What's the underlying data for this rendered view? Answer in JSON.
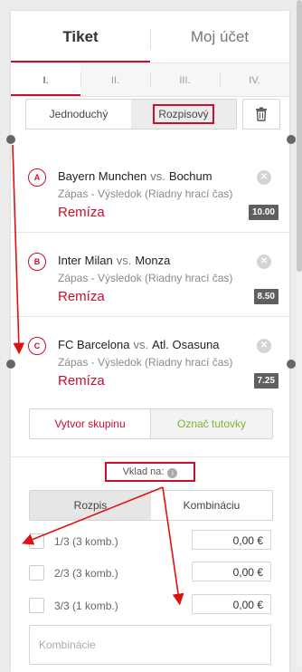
{
  "tabs": {
    "ticket": "Tiket",
    "account": "Moj účet"
  },
  "ticket_numbers": [
    "I.",
    "II.",
    "III.",
    "IV."
  ],
  "modes": {
    "single": "Jednoduchý",
    "system": "Rozpisový"
  },
  "icons": {
    "trash": "trash-icon",
    "close": "close-icon",
    "info": "info-icon"
  },
  "bets": [
    {
      "letter": "A",
      "home": "Bayern Munchen",
      "vs": "vs.",
      "away": "Bochum",
      "market": "Zápas - Výsledok (Riadny hrací čas)",
      "pick": "Remíza",
      "odds": "10.00"
    },
    {
      "letter": "B",
      "home": "Inter Milan",
      "vs": "vs.",
      "away": "Monza",
      "market": "Zápas - Výsledok (Riadny hrací čas)",
      "pick": "Remíza",
      "odds": "8.50"
    },
    {
      "letter": "C",
      "home": "FC Barcelona",
      "vs": "vs.",
      "away": "Atl. Osasuna",
      "market": "Zápas - Výsledok (Riadny hrací čas)",
      "pick": "Remíza",
      "odds": "7.25"
    }
  ],
  "actions": {
    "create_group": "Vytvor skupinu",
    "mark_banker": "Označ tutovky"
  },
  "stake": {
    "label": "Vklad na:",
    "option_system": "Rozpis",
    "option_combination": "Kombináciu"
  },
  "combinations": [
    {
      "label": "1/3 (3 komb.)",
      "amount": "0,00 €"
    },
    {
      "label": "2/3 (3 komb.)",
      "amount": "0,00 €"
    },
    {
      "label": "3/3 (1 komb.)",
      "amount": "0,00 €"
    }
  ],
  "combinations_placeholder": "Kombinácie",
  "colors": {
    "accent": "#c8102e",
    "green": "#7bb62d",
    "odds_bg": "#5f5f5f"
  }
}
